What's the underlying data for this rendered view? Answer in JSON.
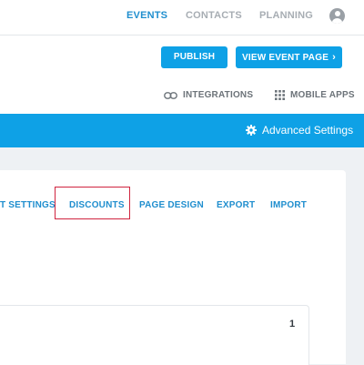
{
  "topnav": {
    "items": [
      {
        "label": "EVENTS",
        "active": true
      },
      {
        "label": "CONTACTS",
        "active": false
      },
      {
        "label": "PLANNING",
        "active": false
      }
    ],
    "avatar_icon": "user-circle-icon"
  },
  "actions": {
    "publish_label": "PUBLISH",
    "view_event_label": "VIEW EVENT PAGE",
    "view_event_chevron": "›"
  },
  "tools": {
    "integrations_label": "INTEGRATIONS",
    "integrations_icon": "link-icon",
    "mobile_apps_label": "MOBILE APPS",
    "mobile_apps_icon": "grid-dots-icon"
  },
  "settings_bar": {
    "advanced_label": "Advanced Settings",
    "advanced_icon": "gear-icon"
  },
  "tabs": {
    "items": [
      {
        "label": "T SETTINGS"
      },
      {
        "label": "DISCOUNTS",
        "highlighted": true
      },
      {
        "label": "PAGE DESIGN"
      },
      {
        "label": "EXPORT"
      },
      {
        "label": "IMPORT"
      }
    ]
  },
  "content": {
    "counter": "1"
  },
  "colors": {
    "accent": "#0ea1e6",
    "link": "#1f8ece",
    "highlight_border": "#d0243f",
    "muted": "#a7adb3"
  }
}
